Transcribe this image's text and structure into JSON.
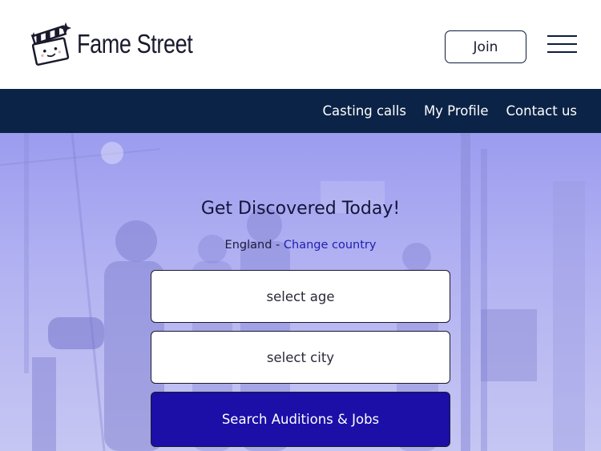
{
  "header": {
    "brand": "Fame Street",
    "join_label": "Join"
  },
  "nav": {
    "items": [
      "Casting calls",
      "My Profile",
      "Contact us"
    ]
  },
  "hero": {
    "title": "Get Discovered Today!",
    "country": "England",
    "separator": " - ",
    "change_country": "Change country",
    "age_placeholder": "select age",
    "city_placeholder": "select city",
    "search_label": "Search Auditions & Jobs"
  },
  "colors": {
    "nav_bg": "#0b2346",
    "accent": "#1b0fa8",
    "hero_tint": "#a8a8f2"
  },
  "icons": {
    "logo": "clapperboard-icon",
    "menu": "hamburger-menu-icon"
  }
}
